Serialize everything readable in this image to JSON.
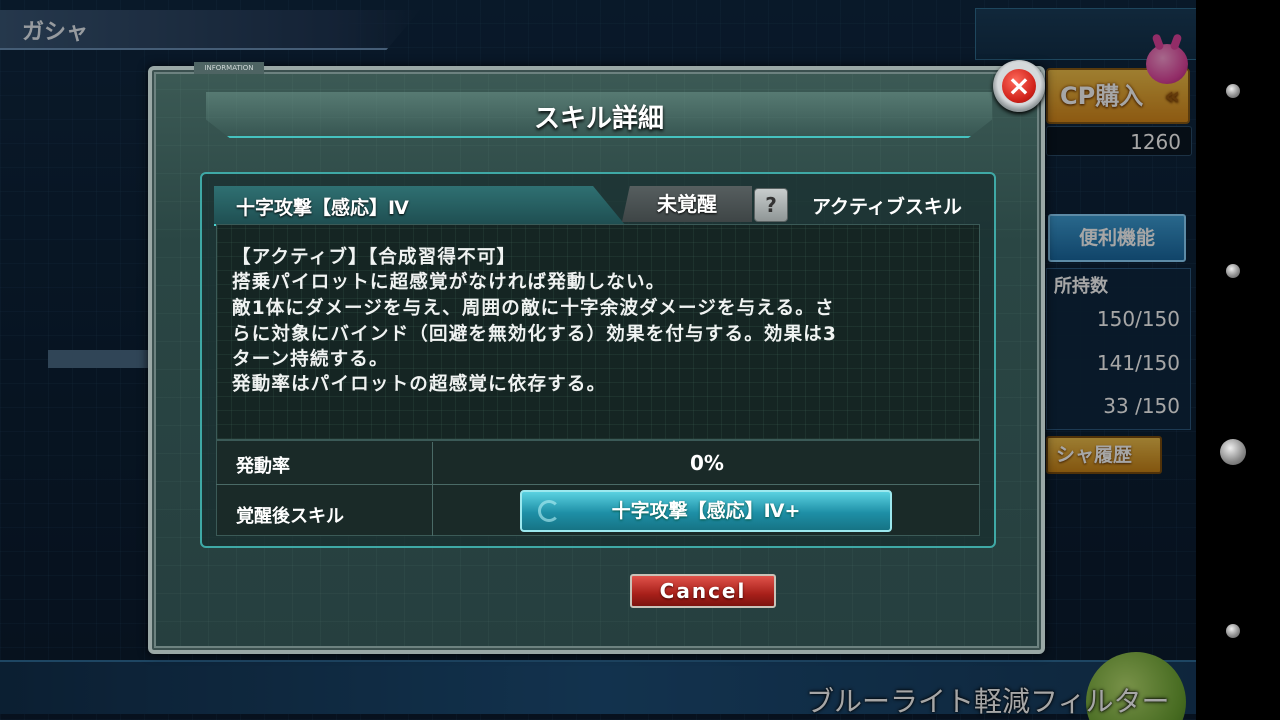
{
  "screen_title": "ガシャ",
  "cp_button_label": "CP購入",
  "cp_amount": "1260",
  "convenience_label": "便利機能",
  "owned": {
    "header": "所持数",
    "values": [
      "150/150",
      "141/150",
      "33 /150"
    ]
  },
  "history_label": "シャ履歴",
  "bluelight_filter": "ブルーライト軽減フィルター",
  "modal": {
    "info_tag": "INFORMATION",
    "title": "スキル詳細",
    "skill_name": "十字攻撃【感応】Ⅳ",
    "awaken_status": "未覚醒",
    "help_label": "?",
    "skill_type": "アクティブスキル",
    "description": [
      "【アクティブ】【合成習得不可】",
      "搭乗パイロットに超感覚がなければ発動しない。",
      "敵1体にダメージを与え、周囲の敵に十字余波ダメージを与える。さ",
      "らに対象にバインド（回避を無効化する）効果を付与する。効果は3",
      "ターン持続する。",
      "発動率はパイロットの超感覚に依存する。"
    ],
    "activation_rate_label": "発動率",
    "activation_rate_value": "0%",
    "after_awaken_label": "覚醒後スキル",
    "after_awaken_skill": "十字攻撃【感応】Ⅳ+",
    "cancel_label": "Cancel",
    "close_label": "×"
  },
  "colors": {
    "accent_teal": "#45c2bf",
    "cancel_red": "#c0281f",
    "cp_orange": "#e0a030"
  }
}
